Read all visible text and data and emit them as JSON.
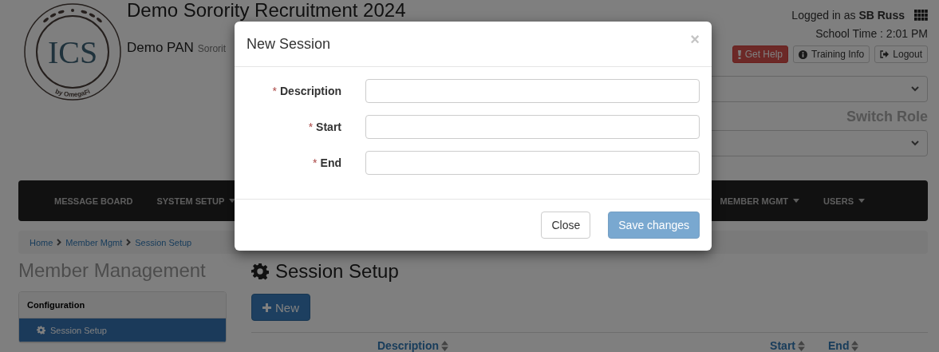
{
  "header": {
    "title": "Demo Sorority Recruitment 2024",
    "org": "Demo PAN",
    "org_type": "Sororit",
    "logo_text": "ICS",
    "logo_byline": "by OmegaFi",
    "user_line": "Logged in as **SB Russ**",
    "school_time": "School Time : 2:01 PM",
    "buttons": [
      {
        "label": "Get Help",
        "kind": "danger"
      },
      {
        "label": "Training Info",
        "kind": "info"
      },
      {
        "label": "Logout",
        "kind": "logout"
      }
    ],
    "switch_role_label": "Switch Role"
  },
  "nav": {
    "left_items": [
      {
        "label": "MESSAGE BOARD",
        "dropdown": false
      },
      {
        "label": "SYSTEM SETUP",
        "dropdown": true
      }
    ],
    "right_items": [
      {
        "label": "MEMBER MGMT",
        "dropdown": true
      },
      {
        "label": "USERS",
        "dropdown": true
      }
    ]
  },
  "breadcrumb": [
    "Home",
    "Member Mgmt",
    "Session Setup"
  ],
  "sidebar": {
    "title": "Member Management",
    "section": "Configuration",
    "items": [
      {
        "label": "Session Setup",
        "selected": true
      }
    ]
  },
  "main": {
    "title": "Session Setup",
    "new_button": "New",
    "columns": [
      "Description",
      "Start",
      "End"
    ]
  },
  "modal": {
    "title": "New Session",
    "close": "×",
    "required_mark": "*",
    "fields": [
      {
        "label": "Description",
        "required": true
      },
      {
        "label": "Start",
        "required": true
      },
      {
        "label": "End",
        "required": true
      }
    ],
    "buttons": [
      {
        "label": "Close",
        "kind": "default",
        "disabled": false
      },
      {
        "label": "Save changes",
        "kind": "primary",
        "disabled": true
      }
    ]
  }
}
